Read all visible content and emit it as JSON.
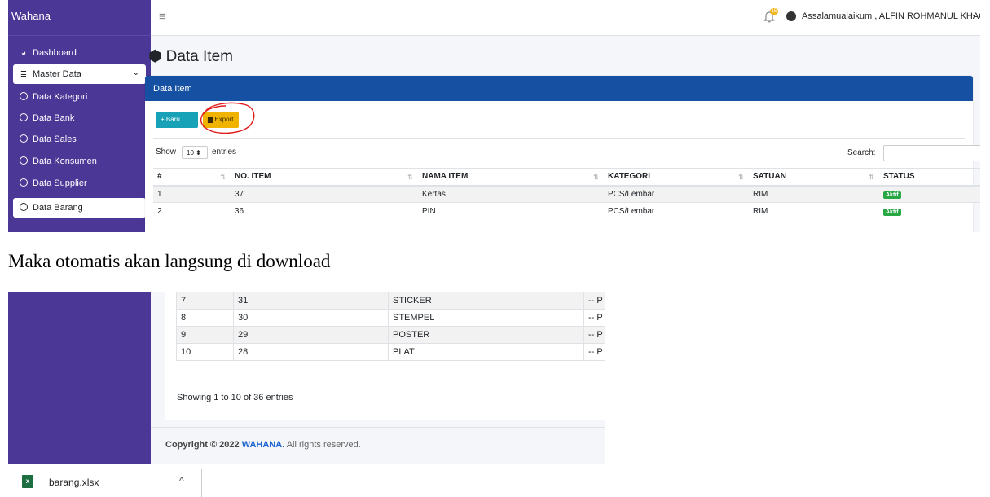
{
  "colors": {
    "sidebar": "#4b3796",
    "card_header": "#1650a3",
    "new_button": "#17a2b8",
    "export_button": "#f0b400",
    "badge": "#28a745",
    "annotation": "#e01919"
  },
  "sidebar": {
    "brand": "Wahana",
    "items": [
      {
        "label": "Dashboard",
        "icon": "dashboard-icon"
      },
      {
        "label": "Master Data",
        "icon": "database-icon"
      },
      {
        "label": "Data Kategori",
        "icon": "circle-icon"
      },
      {
        "label": "Data Bank",
        "icon": "circle-icon"
      },
      {
        "label": "Data Sales",
        "icon": "circle-icon"
      },
      {
        "label": "Data Konsumen",
        "icon": "circle-icon"
      },
      {
        "label": "Data Supplier",
        "icon": "circle-icon"
      },
      {
        "label": "Data Barang",
        "icon": "circle-icon"
      }
    ]
  },
  "topbar": {
    "greeting": "Assalamualaikum , ALFIN ROHMANUL KHAQI",
    "bell_badge": "15"
  },
  "page": {
    "title": "Data Item"
  },
  "card": {
    "header": "Data Item",
    "new_button": "Baru",
    "export_button": "Export",
    "show_label": "Show",
    "show_value": "10",
    "entries_label": "entries",
    "search_label": "Search:"
  },
  "table": {
    "columns": [
      "#",
      "NO. ITEM",
      "NAMA ITEM",
      "KATEGORI",
      "SATUAN",
      "STATUS",
      "#"
    ],
    "rows": [
      {
        "num": "1",
        "no_item": "37",
        "nama": "Kertas",
        "kategori": "PCS/Lembar",
        "satuan": "RIM",
        "status": "Aktif"
      },
      {
        "num": "2",
        "no_item": "36",
        "nama": "PIN",
        "kategori": "PCS/Lembar",
        "satuan": "RIM",
        "status": "Aktif"
      }
    ]
  },
  "caption": "Maka otomatis akan langsung di download",
  "table2": {
    "rows": [
      {
        "num": "7",
        "no_item": "31",
        "nama": "STICKER",
        "kategori": "-- P"
      },
      {
        "num": "8",
        "no_item": "30",
        "nama": "STEMPEL",
        "kategori": "-- P"
      },
      {
        "num": "9",
        "no_item": "29",
        "nama": "POSTER",
        "kategori": "-- P"
      },
      {
        "num": "10",
        "no_item": "28",
        "nama": "PLAT",
        "kategori": "-- P"
      }
    ],
    "showing": "Showing 1 to 10 of 36 entries"
  },
  "footer": {
    "prefix": "Copyright © 2022",
    "brand": "WAHANA.",
    "suffix": "All rights reserved."
  },
  "download": {
    "filename": "barang.xlsx"
  }
}
